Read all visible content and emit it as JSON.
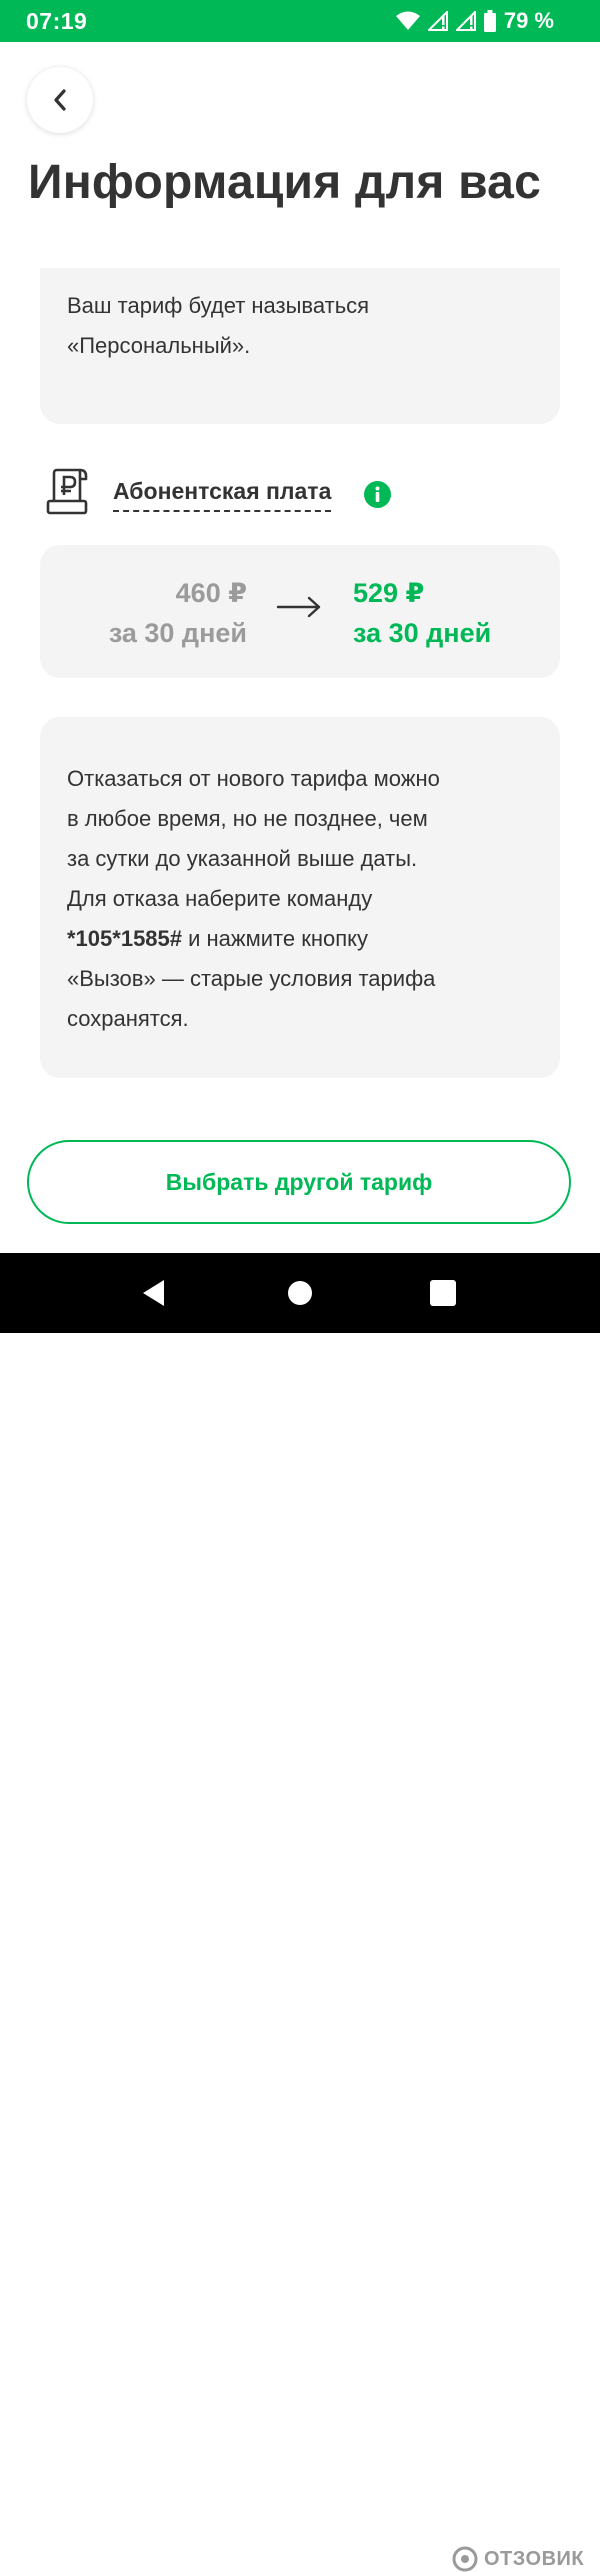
{
  "status_bar": {
    "time": "07:19",
    "battery": "79 %"
  },
  "header": {
    "title": "Информация для вас"
  },
  "tariff_card": {
    "line1": "Ваш тариф будет называться",
    "line2": "«Персональный»."
  },
  "fee": {
    "label": "Абонентская плата",
    "icon": "receipt-ruble-icon",
    "info_icon": "info-icon"
  },
  "price": {
    "old_amount": "460 ₽",
    "old_period": "за 30 дней",
    "new_amount": "529 ₽",
    "new_period": "за 30 дней"
  },
  "info_card": {
    "line1": "Отказаться от нового тарифа можно",
    "line2": "в любое время, но не позднее, чем",
    "line3": "за сутки до указанной выше даты.",
    "line4": "Для отказа наберите команду",
    "code": "*105*1585#",
    "line5_rest": " и нажмите кнопку",
    "line6": "«Вызов» — старые условия тарифа",
    "line7": "сохранятся."
  },
  "actions": {
    "choose_other": "Выбрать другой тариф"
  },
  "watermark": {
    "text": "ОТЗОВИК"
  },
  "colors": {
    "brand_green": "#00b956",
    "card_bg": "#f4f4f4",
    "text_dark": "#333333",
    "text_muted": "#9b9b9b"
  }
}
